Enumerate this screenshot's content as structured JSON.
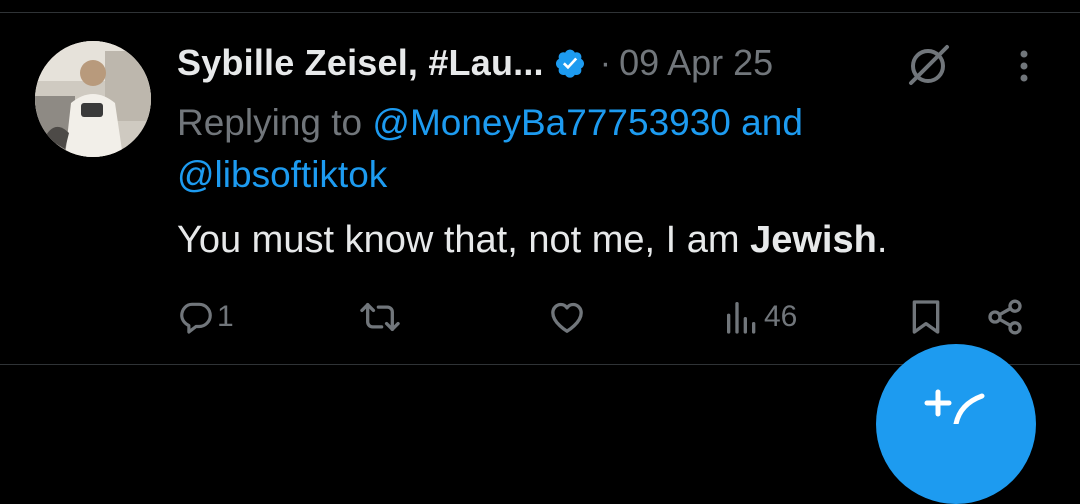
{
  "tweet": {
    "display_name": "Sybille Zeisel, #Lau...",
    "separator": "·",
    "date": "09 Apr 25",
    "reply_prefix": "Replying to ",
    "mention_1": "@MoneyBa77753930",
    "reply_and": " and",
    "mention_2": "@libsoftiktok",
    "text_before": "You must know that, not me, I am ",
    "text_bold": "Jewish",
    "text_after": "."
  },
  "actions": {
    "reply_count": "1",
    "views_count": "46"
  },
  "icons": {
    "verified": "verified-badge-icon",
    "grok": "grok-icon",
    "more": "more-vertical-icon",
    "reply": "reply-icon",
    "retweet": "retweet-icon",
    "like": "heart-icon",
    "views": "views-icon",
    "bookmark": "bookmark-icon",
    "share": "share-icon",
    "compose": "compose-icon"
  },
  "colors": {
    "background": "#000000",
    "accent": "#1d9bf0",
    "text_primary": "#e7e9ea",
    "text_secondary": "#71767b",
    "divider": "#2f3336"
  }
}
